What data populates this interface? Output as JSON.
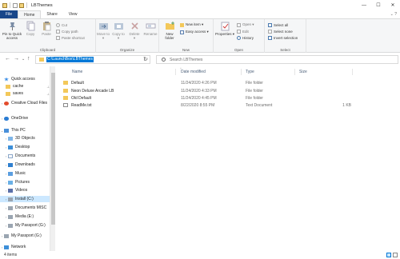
{
  "window": {
    "title": "LBThemes",
    "controls": [
      "—",
      "☐",
      "✕"
    ]
  },
  "ribbon_tabs": [
    "File",
    "Home",
    "Share",
    "View"
  ],
  "ribbon_help": "⌄ ?",
  "ribbon": {
    "clipboard": {
      "label": "Clipboard",
      "pin": "Pin to Quick access",
      "copy": "Copy",
      "paste": "Paste",
      "cut": "Cut",
      "copy_path": "Copy path",
      "paste_shortcut": "Paste shortcut"
    },
    "organize": {
      "label": "Organize",
      "move_to": "Move to ▾",
      "copy_to": "Copy to ▾",
      "delete": "Delete ▾",
      "rename": "Rename"
    },
    "new": {
      "label": "New",
      "new_folder": "New folder",
      "new_item": "New item ▾",
      "easy_access": "Easy access ▾"
    },
    "open": {
      "label": "Open",
      "properties": "Properties ▾",
      "open": "Open ▾",
      "edit": "Edit",
      "history": "History"
    },
    "select": {
      "label": "Select",
      "select_all": "Select all",
      "select_none": "Select none",
      "invert": "Invert selection"
    }
  },
  "address": {
    "path": "C:\\LaunchBox\\LBThemes",
    "search_placeholder": "Search LBThemes"
  },
  "nav": {
    "back": "←",
    "forward": "→",
    "dropdown": "⌄",
    "up": "↑",
    "refresh": "↻",
    "items": [
      {
        "label": "Quick access",
        "arrow": "",
        "pinned": false
      },
      {
        "label": "cache",
        "arrow": "",
        "pinned": true
      },
      {
        "label": "saves",
        "arrow": "",
        "pinned": true
      },
      {
        "label": "Creative Cloud Files",
        "arrow": "›",
        "pinned": false
      },
      {
        "label": "OneDrive",
        "arrow": "›",
        "pinned": false
      },
      {
        "label": "This PC",
        "arrow": "⌄",
        "pinned": false
      },
      {
        "label": "3D Objects",
        "arrow": "›",
        "pinned": false
      },
      {
        "label": "Desktop",
        "arrow": "›",
        "pinned": false
      },
      {
        "label": "Documents",
        "arrow": "›",
        "pinned": false
      },
      {
        "label": "Downloads",
        "arrow": "›",
        "pinned": false
      },
      {
        "label": "Music",
        "arrow": "›",
        "pinned": false
      },
      {
        "label": "Pictures",
        "arrow": "›",
        "pinned": false
      },
      {
        "label": "Videos",
        "arrow": "›",
        "pinned": false
      },
      {
        "label": "Install (C:)",
        "arrow": "›",
        "pinned": false
      },
      {
        "label": "Documents MISC",
        "arrow": "›",
        "pinned": false
      },
      {
        "label": "Media (E:)",
        "arrow": "›",
        "pinned": false
      },
      {
        "label": "My Passport (G:)",
        "arrow": "›",
        "pinned": false
      },
      {
        "label": "My Passport (G:)",
        "arrow": "›",
        "pinned": false
      },
      {
        "label": "Network",
        "arrow": "›",
        "pinned": false
      }
    ]
  },
  "columns": {
    "name": "Name",
    "date": "Date modified",
    "type": "Type",
    "size": "Size",
    "sort_indicator": "^"
  },
  "files": [
    {
      "name": "Default",
      "date": "11/24/2020 4:26 PM",
      "type": "File folder",
      "size": "",
      "kind": "folder"
    },
    {
      "name": "Neon Deluxe Arcade LB",
      "date": "11/24/2020 4:33 PM",
      "type": "File folder",
      "size": "",
      "kind": "folder"
    },
    {
      "name": "Old Default",
      "date": "11/24/2020 4:45 PM",
      "type": "File folder",
      "size": "",
      "kind": "folder"
    },
    {
      "name": "ReadMe.txt",
      "date": "8/22/2020 8:55 PM",
      "type": "Text Document",
      "size": "1 KB",
      "kind": "text"
    }
  ],
  "status": {
    "item_count": "4 items"
  },
  "colors": {
    "accent": "#0078d7",
    "file_tab": "#19478a",
    "folder": "#f3c85a",
    "selection": "#cce8ff"
  }
}
